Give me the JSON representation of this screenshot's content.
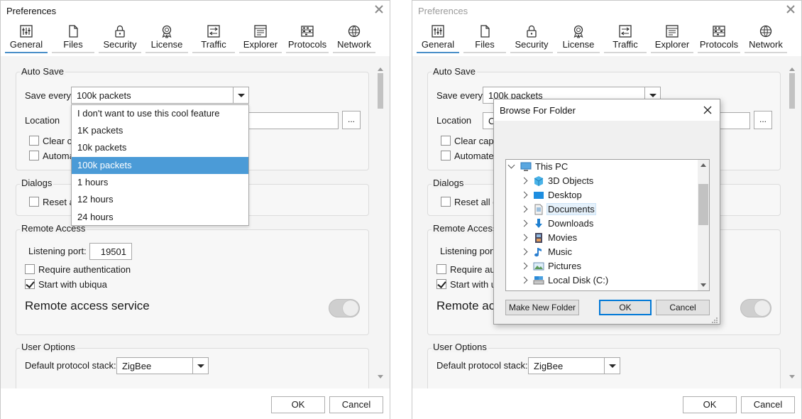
{
  "left": {
    "title": "Preferences",
    "tabs": [
      {
        "label": "General",
        "icon": "sliders-icon"
      },
      {
        "label": "Files",
        "icon": "file-icon"
      },
      {
        "label": "Security",
        "icon": "lock-icon"
      },
      {
        "label": "License",
        "icon": "award-icon"
      },
      {
        "label": "Traffic",
        "icon": "traffic-icon"
      },
      {
        "label": "Explorer",
        "icon": "explorer-icon"
      },
      {
        "label": "Protocols",
        "icon": "protocols-icon"
      },
      {
        "label": "Network",
        "icon": "globe-icon"
      }
    ],
    "auto_save": {
      "title": "Auto Save",
      "save_every_label": "Save every",
      "save_every_value": "100k packets",
      "location_label": "Location",
      "browse_label": "...",
      "clear_label": "Clear ca",
      "automatic_label": "Automa"
    },
    "dropdown": {
      "options": [
        "I don't want to use this cool feature",
        "1K packets",
        "10k packets",
        "100k packets",
        "1 hours",
        "12 hours",
        "24 hours"
      ],
      "selected_index": 3
    },
    "dialogs": {
      "title": "Dialogs",
      "reset_label": "Reset al"
    },
    "remote": {
      "title": "Remote Access",
      "port_label": "Listening port:",
      "port_value": "19501",
      "require_auth_label": "Require authentication",
      "start_label": "Start with ubiqua",
      "service_label": "Remote access service"
    },
    "user_options": {
      "title": "User Options",
      "stack_label": "Default protocol stack:",
      "stack_value": "ZigBee"
    },
    "footer": {
      "ok": "OK",
      "cancel": "Cancel"
    }
  },
  "right": {
    "title": "Preferences",
    "tabs": [
      {
        "label": "General"
      },
      {
        "label": "Files"
      },
      {
        "label": "Security"
      },
      {
        "label": "License"
      },
      {
        "label": "Traffic"
      },
      {
        "label": "Explorer"
      },
      {
        "label": "Protocols"
      },
      {
        "label": "Network"
      }
    ],
    "auto_save": {
      "title": "Auto Save",
      "save_every_label": "Save every",
      "save_every_value": "100k packets",
      "location_label": "Location",
      "location_value": "C",
      "browse_label": "...",
      "clear_label": "Clear captu",
      "automatic_label": "Automated"
    },
    "dialogs": {
      "title": "Dialogs",
      "reset_label": "Reset all di"
    },
    "remote": {
      "title": "Remote Access",
      "port_label": "Listening port",
      "require_auth_label": "Require auti",
      "start_label": "Start with ul",
      "service_label": "Remote acc"
    },
    "user_options": {
      "title": "User Options",
      "stack_label": "Default protocol stack:",
      "stack_value": "ZigBee"
    },
    "footer": {
      "ok": "OK",
      "cancel": "Cancel"
    },
    "browse_dialog": {
      "title": "Browse For Folder",
      "root": "This PC",
      "items": [
        "3D Objects",
        "Desktop",
        "Documents",
        "Downloads",
        "Movies",
        "Music",
        "Pictures",
        "Local Disk (C:)"
      ],
      "highlighted": "Documents",
      "make_folder": "Make New Folder",
      "ok": "OK",
      "cancel": "Cancel"
    }
  },
  "colors": {
    "accent": "#4a8fc8",
    "selection": "#4b9bd7",
    "default_button": "#0078d7"
  }
}
